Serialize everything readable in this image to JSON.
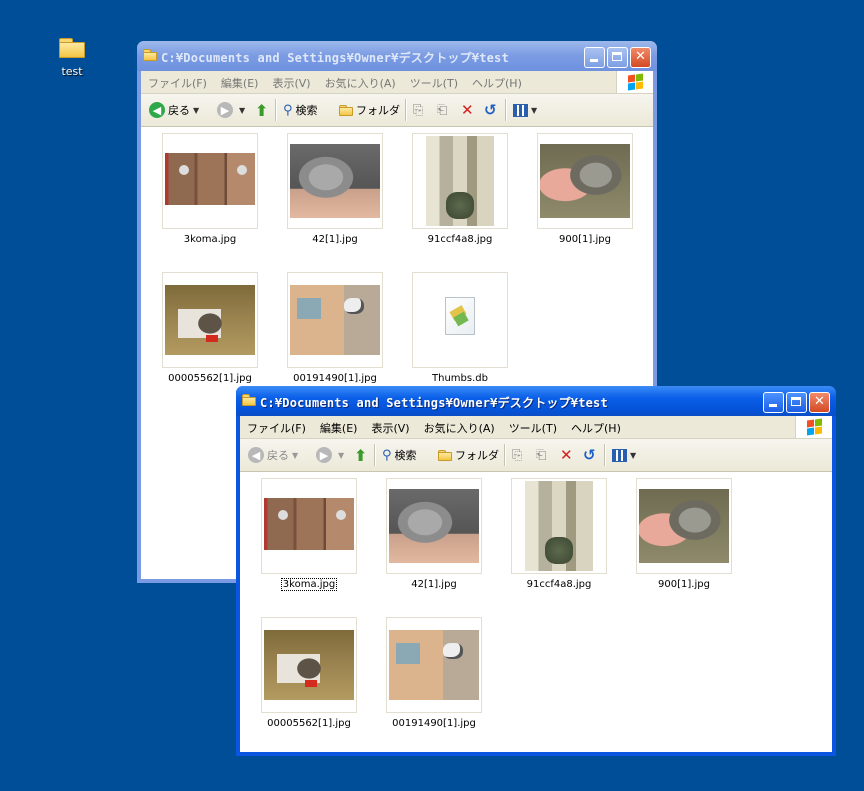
{
  "desktop": {
    "icons": [
      {
        "label": "test"
      }
    ]
  },
  "window_back": {
    "title": "C:¥Documents and Settings¥Owner¥デスクトップ¥test",
    "state": "inactive"
  },
  "window_front": {
    "title": "C:¥Documents and Settings¥Owner¥デスクトップ¥test",
    "state": "active"
  },
  "menu": {
    "items": [
      "ファイル(F)",
      "編集(E)",
      "表示(V)",
      "お気に入り(A)",
      "ツール(T)",
      "ヘルプ(H)"
    ]
  },
  "toolbar": {
    "back_label": "戻る",
    "search_label": "検索",
    "folders_label": "フォルダ"
  },
  "files_back": [
    {
      "name": "3koma.jpg",
      "icon": "image-thumbnail"
    },
    {
      "name": "42[1].jpg",
      "icon": "image-thumbnail"
    },
    {
      "name": "91ccf4a8.jpg",
      "icon": "image-thumbnail"
    },
    {
      "name": "900[1].jpg",
      "icon": "image-thumbnail"
    },
    {
      "name": "00005562[1].jpg",
      "icon": "image-thumbnail"
    },
    {
      "name": "00191490[1].jpg",
      "icon": "image-thumbnail"
    },
    {
      "name": "Thumbs.db",
      "icon": "db-file-icon"
    }
  ],
  "files_front": [
    {
      "name": "3koma.jpg",
      "icon": "image-thumbnail",
      "selected": true
    },
    {
      "name": "42[1].jpg",
      "icon": "image-thumbnail"
    },
    {
      "name": "91ccf4a8.jpg",
      "icon": "image-thumbnail"
    },
    {
      "name": "900[1].jpg",
      "icon": "image-thumbnail"
    },
    {
      "name": "00005562[1].jpg",
      "icon": "image-thumbnail"
    },
    {
      "name": "00191490[1].jpg",
      "icon": "image-thumbnail"
    }
  ],
  "colors": {
    "desktop": "#004e98",
    "active_title": "#0a5fe8",
    "inactive_title": "#7b9be3",
    "chrome": "#ece9d8"
  }
}
